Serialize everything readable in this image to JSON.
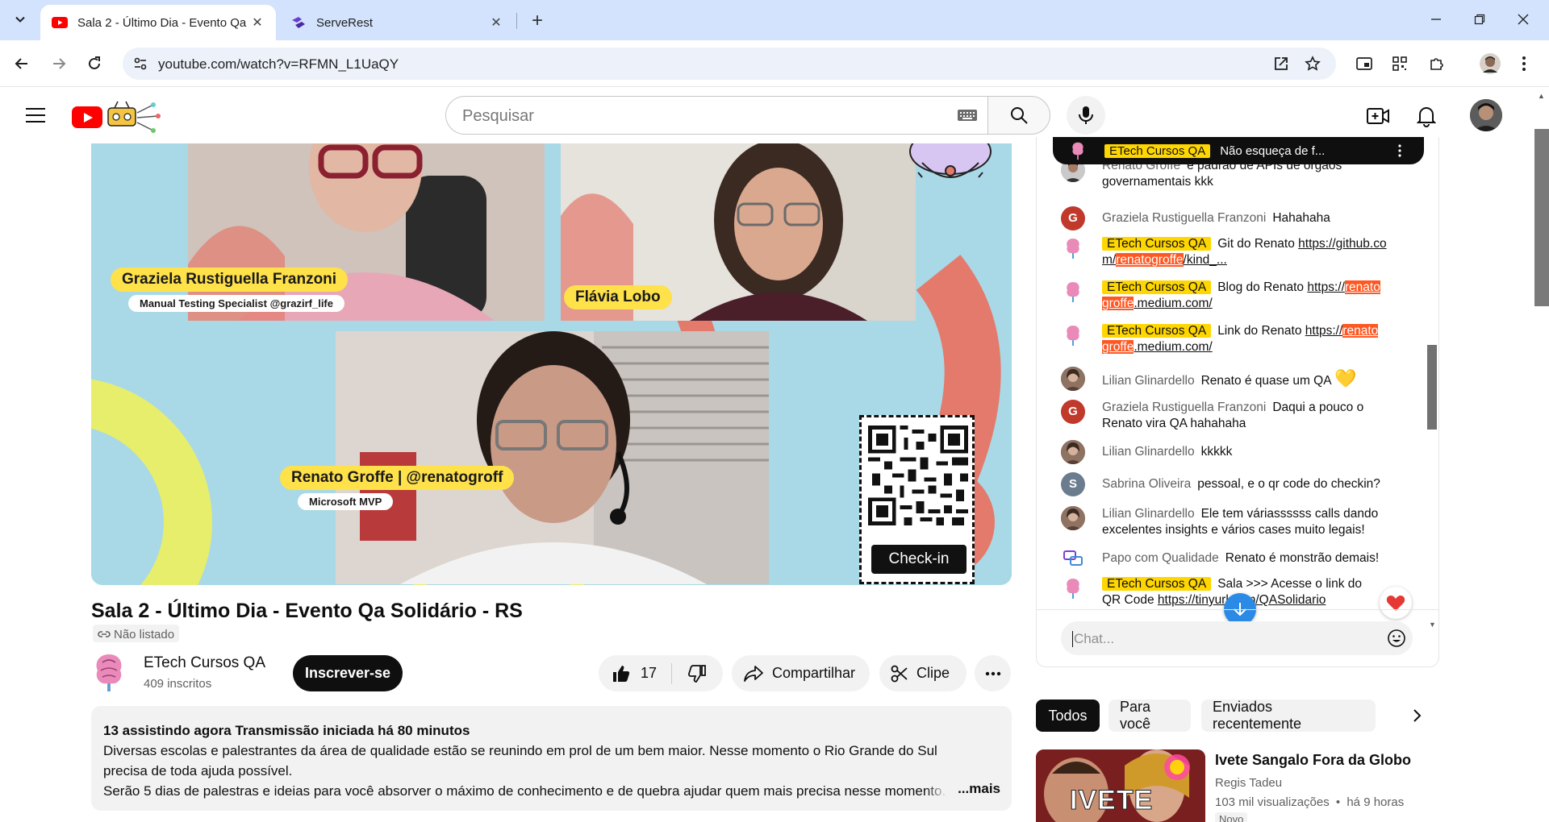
{
  "browser": {
    "tabs": [
      {
        "title": "Sala 2 - Último Dia - Evento Qa",
        "active": true
      },
      {
        "title": "ServeRest",
        "active": false
      }
    ],
    "url": "youtube.com/watch?v=RFMN_L1UaQY"
  },
  "masthead": {
    "search_placeholder": "Pesquisar"
  },
  "video": {
    "overlay": {
      "speaker1_name": "Graziela Rustiguella Franzoni",
      "speaker1_role": "Manual Testing Specialist @grazirf_life",
      "speaker2_name": "Flávia Lobo",
      "speaker3_name": "Renato Groffe | @renatogroff",
      "speaker3_role": "Microsoft MVP",
      "checkin_label": "Check-in"
    },
    "title": "Sala 2 - Último Dia - Evento Qa Solidário - RS",
    "visibility": "Não listado",
    "channel_name": "ETech Cursos QA",
    "subscribers": "409 inscritos",
    "subscribe_label": "Inscrever-se",
    "likes": "17",
    "share_label": "Compartilhar",
    "clip_label": "Clipe"
  },
  "description": {
    "meta": "13 assistindo agora  Transmissão iniciada há 80 minutos",
    "line1": "Diversas escolas e palestrantes da área de qualidade estão se reunindo em prol de um bem maior. Nesse momento o Rio Grande do Sul",
    "line2": "precisa de toda ajuda possível.",
    "line3": "Serão 5 dias de palestras e ideias para você absorver o máximo de conhecimento e de quebra ajudar quem mais precisa nesse momento.",
    "more_label": "...mais"
  },
  "chat": {
    "pinned": {
      "author": "ETech Cursos QA",
      "text": "Não esqueça de f..."
    },
    "messages": [
      {
        "author": "Renato Groffe",
        "text": "é padrão de APIs de órgãos governamentais kkk"
      },
      {
        "author": "Graziela Rustiguella Franzoni",
        "text": "Hahahaha",
        "initial": "G"
      },
      {
        "author": "ETech Cursos QA",
        "text_before": "Git do Renato ",
        "link1": "https://github.co m/",
        "hl": "renatogroffe",
        "link2": "/kind_..."
      },
      {
        "author": "ETech Cursos QA",
        "text_before": "Blog do Renato ",
        "link1": "https://",
        "hl": "renato groffe",
        "link2": ".medium.com/"
      },
      {
        "author": "ETech Cursos QA",
        "text_before": "Link do Renato ",
        "link1": "https://",
        "hl": "renato groffe",
        "link2": ".medium.com/"
      },
      {
        "author": "Lilian Glinardello",
        "text": "Renato é quase um QA",
        "emoji": "💛"
      },
      {
        "author": "Graziela Rustiguella Franzoni",
        "text": "Daqui a pouco o Renato vira QA hahahaha",
        "initial": "G"
      },
      {
        "author": "Lilian Glinardello",
        "text": "kkkkk"
      },
      {
        "author": "Sabrina Oliveira",
        "text": "pessoal, e o qr code do checkin?",
        "initial": "S"
      },
      {
        "author": "Lilian Glinardello",
        "text": "Ele tem váriassssss calls dando excelentes insights e vários cases muito legais!"
      },
      {
        "author": "Papo com Qualidade",
        "text": "Renato é monstrão demais!"
      },
      {
        "author": "ETech Cursos QA",
        "text_before": "Sala",
        "text_mid": " >>> Acesse o link do",
        "text_after": "QR Code ",
        "link1": "https://tinyurl.com/QASolidario"
      }
    ],
    "input_placeholder": "Chat..."
  },
  "chips": [
    "Todos",
    "Para você",
    "Enviados recentemente"
  ],
  "recommendation": {
    "title": "Ivete Sangalo Fora da Globo",
    "channel": "Regis Tadeu",
    "views": "103 mil visualizações",
    "age": "há 9 horas",
    "badge": "Novo",
    "thumb_text": "IVETE"
  },
  "colors": {
    "brand_red": "#ff0000",
    "moderator_yellow": "#ffd600",
    "highlight_orange": "#ff5722",
    "chrome_blue": "#d3e3fd"
  }
}
